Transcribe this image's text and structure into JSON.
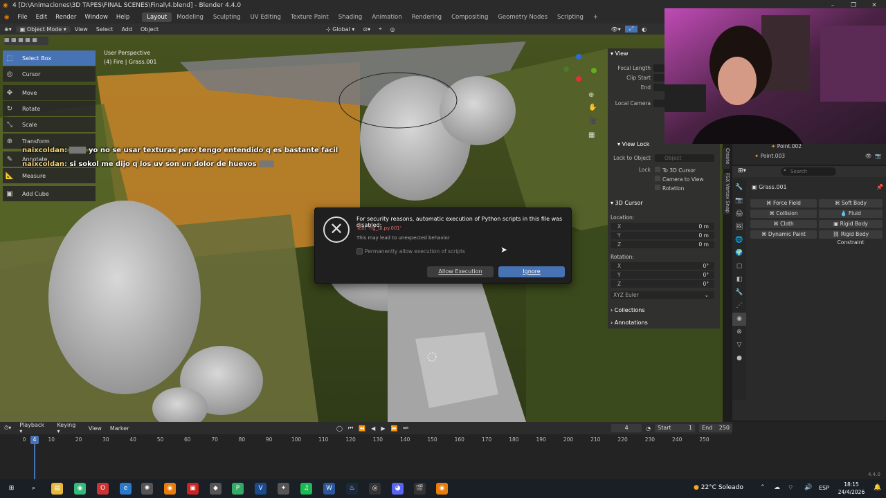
{
  "window": {
    "title": "4 [D:\\Animaciones\\3D TAPES\\FINAL SCENES\\Final\\4.blend] - Blender 4.4.0"
  },
  "menu": {
    "items": [
      "File",
      "Edit",
      "Render",
      "Window",
      "Help"
    ],
    "workspaces": [
      "Layout",
      "Modeling",
      "Sculpting",
      "UV Editing",
      "Texture Paint",
      "Shading",
      "Animation",
      "Rendering",
      "Compositing",
      "Geometry Nodes",
      "Scripting"
    ],
    "active_workspace": "Layout"
  },
  "header3d": {
    "mode": "Object Mode",
    "view": "View",
    "select": "Select",
    "add": "Add",
    "object": "Object",
    "orientation": "Global"
  },
  "viewport": {
    "perspective": "User Perspective",
    "context": "(4) Fire | Grass.001"
  },
  "toolbar": {
    "select_box": "Select Box",
    "cursor": "Cursor",
    "move": "Move",
    "rotate": "Rotate",
    "scale": "Scale",
    "transform": "Transform",
    "annotate": "Annotate",
    "measure": "Measure",
    "add_cube": "Add Cube"
  },
  "chat": [
    {
      "user": "naixcoldan:",
      "text": "yo no se usar texturas pero tengo entendido q es bastante facil"
    },
    {
      "user": "naixcoldan:",
      "text": "si sokol me dijo q los uv son un dolor de huevos"
    }
  ],
  "dialog": {
    "message": "For security reasons, automatic execution of Python scripts in this file was disabled:",
    "error": "Text 'rig_ui.py.001'",
    "sub": "This may lead to unexpected behavior",
    "checkbox": "Permanently allow execution of scripts",
    "allow": "Allow Execution",
    "ignore": "Ignore"
  },
  "npanel": {
    "view_header": "View",
    "focal_length": "Focal Length",
    "clip_start": "Clip Start",
    "end": "End",
    "local_camera": "Local Camera",
    "view_lock_header": "View Lock",
    "lock_to_object": "Lock to Object",
    "object_placeholder": "Object",
    "lock": "Lock",
    "to_3d_cursor": "To 3D Cursor",
    "camera_to_view": "Camera to View",
    "rotation_lock": "Rotation",
    "cursor_header": "3D Cursor",
    "location": "Location:",
    "loc": [
      {
        "k": "X",
        "v": "0 m"
      },
      {
        "k": "Y",
        "v": "0 m"
      },
      {
        "k": "Z",
        "v": "0 m"
      }
    ],
    "rotation": "Rotation:",
    "rot": [
      {
        "k": "X",
        "v": "0°"
      },
      {
        "k": "Y",
        "v": "0°"
      },
      {
        "k": "Z",
        "v": "0°"
      }
    ],
    "euler": "XYZ Euler",
    "collections": "Collections",
    "annotations": "Annotations"
  },
  "side_tabs": {
    "create": "Create",
    "fsx": "FSX Vertex Snap"
  },
  "outliner": {
    "items": [
      "Point.002",
      "Point.003"
    ]
  },
  "properties": {
    "search_placeholder": "Search",
    "object_name": "Grass.001",
    "physics_buttons": [
      "Force Field",
      "Soft Body",
      "Collision",
      "Fluid",
      "Cloth",
      "Rigid Body",
      "Dynamic Paint",
      "Rigid Body Constraint"
    ]
  },
  "timeline": {
    "playback": "Playback",
    "keying": "Keying",
    "view": "View",
    "marker": "Marker",
    "current_frame": "4",
    "start_label": "Start",
    "start": "1",
    "end_label": "End",
    "end": "250",
    "ticks": [
      "0",
      "10",
      "20",
      "30",
      "40",
      "50",
      "60",
      "70",
      "80",
      "90",
      "100",
      "110",
      "120",
      "130",
      "140",
      "150",
      "160",
      "170",
      "180",
      "190",
      "200",
      "210",
      "220",
      "230",
      "240",
      "250"
    ],
    "version": "4.4.0"
  },
  "taskbar": {
    "weather": "22°C  Soleado",
    "lang": "ESP",
    "time": "18:15",
    "date": "24/4/2026"
  },
  "colors": {
    "accent": "#4772b3",
    "panel": "#303030",
    "error": "#e46d6d"
  }
}
